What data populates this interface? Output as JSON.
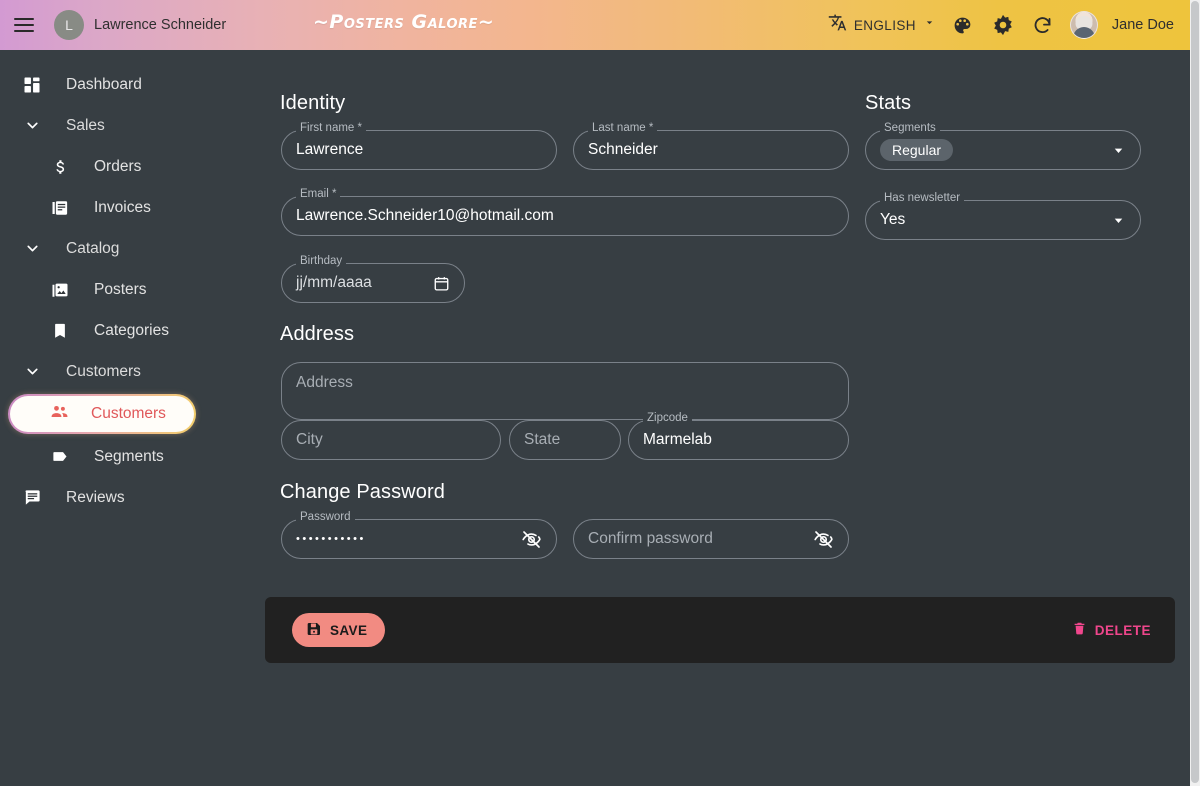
{
  "header": {
    "menu_icon": "hamburger-menu-icon",
    "user_initial": "L",
    "user_name": "Lawrence Schneider",
    "brand": "~Posters Galore~",
    "language": "ENGLISH",
    "language_icon": "translate-icon",
    "language_caret_icon": "chevron-down-icon",
    "theme_icon": "palette-icon",
    "brightness_icon": "brightness-gear-icon",
    "refresh_icon": "refresh-icon",
    "account_name": "Jane Doe",
    "gradient_from": "#d39ad2",
    "gradient_to": "#eec43c"
  },
  "sidebar": {
    "items": [
      {
        "label": "Dashboard",
        "icon": "dashboard-icon",
        "level": "top",
        "active": false
      },
      {
        "label": "Sales",
        "icon": "chevron-down-icon",
        "level": "group",
        "active": false
      },
      {
        "label": "Orders",
        "icon": "dollar-icon",
        "level": "sub",
        "active": false
      },
      {
        "label": "Invoices",
        "icon": "invoice-icon",
        "level": "sub",
        "active": false
      },
      {
        "label": "Catalog",
        "icon": "chevron-down-icon",
        "level": "group",
        "active": false
      },
      {
        "label": "Posters",
        "icon": "image-icon",
        "level": "sub",
        "active": false
      },
      {
        "label": "Categories",
        "icon": "bookmark-icon",
        "level": "sub",
        "active": false
      },
      {
        "label": "Customers",
        "icon": "chevron-down-icon",
        "level": "group",
        "active": false
      },
      {
        "label": "Customers",
        "icon": "people-icon",
        "level": "sub",
        "active": true
      },
      {
        "label": "Segments",
        "icon": "tag-icon",
        "level": "sub",
        "active": false
      },
      {
        "label": "Reviews",
        "icon": "comment-icon",
        "level": "top",
        "active": false
      }
    ],
    "active_text_color": "#e0585a"
  },
  "form": {
    "identity": {
      "title": "Identity",
      "first_name": {
        "label": "First name",
        "required": "*",
        "value": "Lawrence"
      },
      "last_name": {
        "label": "Last name",
        "required": "*",
        "value": "Schneider"
      },
      "email": {
        "label": "Email",
        "required": "*",
        "value": "Lawrence.Schneider10@hotmail.com"
      },
      "birthday": {
        "label": "Birthday",
        "placeholder": "jj/mm/aaaa",
        "icon": "calendar-icon"
      }
    },
    "stats": {
      "title": "Stats",
      "segments": {
        "label": "Segments",
        "chip": "Regular",
        "caret_icon": "chevron-down-icon"
      },
      "newsletter": {
        "label": "Has newsletter",
        "value": "Yes",
        "caret_icon": "chevron-down-icon"
      }
    },
    "address": {
      "title": "Address",
      "street": {
        "placeholder": "Address"
      },
      "city": {
        "placeholder": "City"
      },
      "state": {
        "placeholder": "State"
      },
      "zipcode": {
        "label": "Zipcode",
        "value": "Marmelab"
      }
    },
    "password": {
      "title": "Change Password",
      "password": {
        "label": "Password",
        "value": "•••••••••••",
        "toggle_icon": "eye-off-icon"
      },
      "confirm": {
        "placeholder": "Confirm password",
        "toggle_icon": "eye-off-icon"
      }
    }
  },
  "toolbar": {
    "save_label": "SAVE",
    "save_icon": "save-icon",
    "save_color": "#f28b82",
    "delete_label": "DELETE",
    "delete_icon": "trash-icon",
    "delete_color": "#f0468c"
  }
}
